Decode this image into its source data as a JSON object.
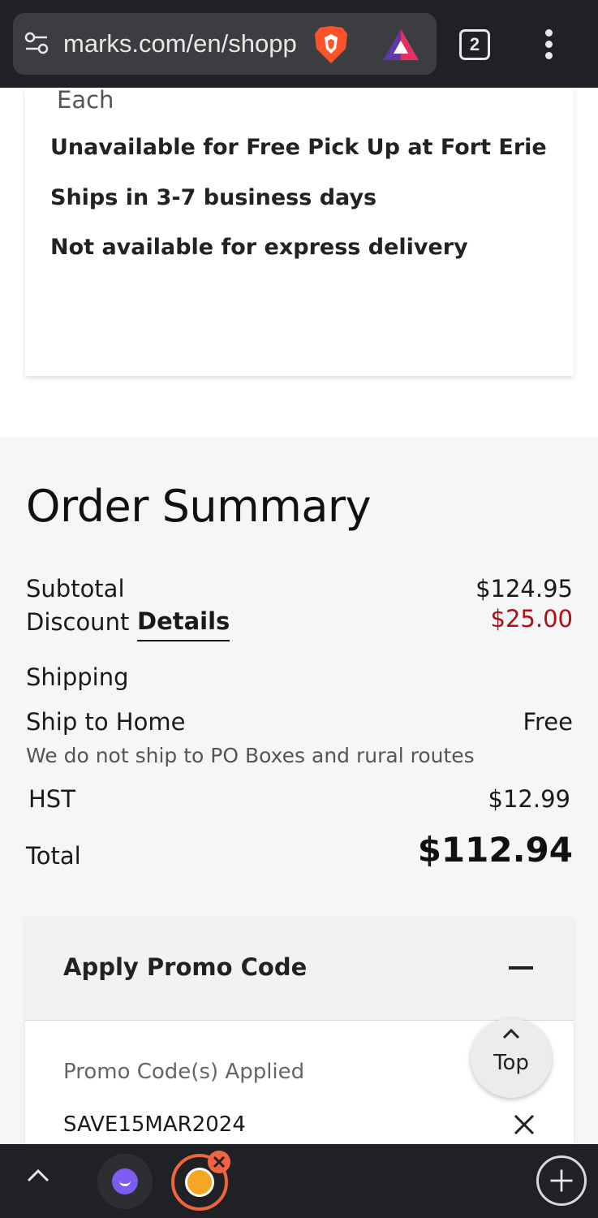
{
  "browser": {
    "url": "marks.com/en/shopp",
    "tab_count": "2"
  },
  "product": {
    "each_label": "Each",
    "availability": [
      "Unavailable for Free Pick Up at Fort Erie",
      "Ships in 3-7 business days",
      "Not available for express delivery"
    ]
  },
  "summary": {
    "title": "Order Summary",
    "subtotal_label": "Subtotal",
    "subtotal_value": "$124.95",
    "discount_label": "Discount",
    "discount_details_label": "Details",
    "discount_value": "$25.00",
    "shipping_label": "Shipping",
    "ship_home_label": "Ship to Home",
    "ship_home_value": "Free",
    "ship_note": "We do not ship to PO Boxes and rural routes",
    "tax_label": "HST",
    "tax_value": "$12.99",
    "total_label": "Total",
    "total_value": "$112.94"
  },
  "promo": {
    "title": "Apply Promo Code",
    "applied_label": "Promo Code(s) Applied",
    "code": "SAVE15MAR2024"
  },
  "top_button": {
    "label": "Top"
  },
  "colors": {
    "discount": "#b00e14",
    "browser_bar": "#202124",
    "accent": "#f0653f"
  }
}
